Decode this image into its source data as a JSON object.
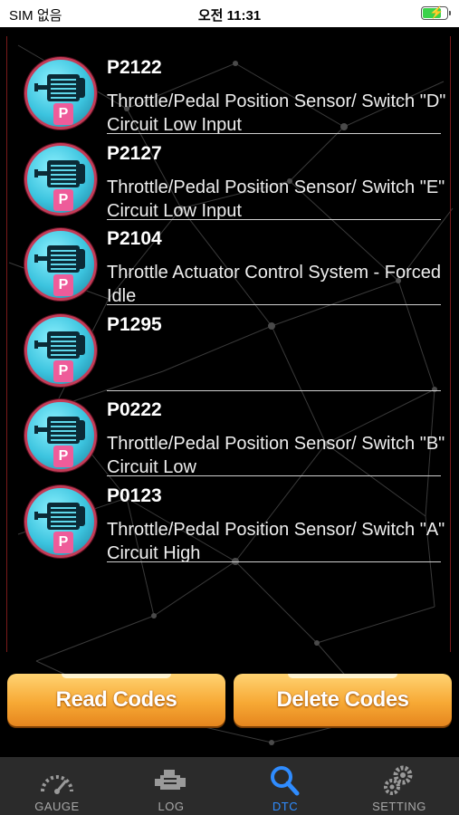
{
  "status_bar": {
    "carrier": "SIM 없음",
    "time": "오전 11:31"
  },
  "dtc_list": [
    {
      "code": "P2122",
      "description": "Throttle/Pedal Position Sensor/ Switch \"D\" Circuit Low Input",
      "icon": "motor-icon",
      "badge": "P"
    },
    {
      "code": "P2127",
      "description": "Throttle/Pedal Position Sensor/ Switch \"E\" Circuit Low Input",
      "icon": "motor-icon",
      "badge": "P"
    },
    {
      "code": "P2104",
      "description": "Throttle Actuator Control System - Forced Idle",
      "icon": "motor-icon",
      "badge": "P"
    },
    {
      "code": "P1295",
      "description": "",
      "icon": "motor-icon",
      "badge": "P"
    },
    {
      "code": "P0222",
      "description": "Throttle/Pedal Position Sensor/ Switch \"B\" Circuit Low",
      "icon": "motor-icon",
      "badge": "P"
    },
    {
      "code": "P0123",
      "description": "Throttle/Pedal Position Sensor/ Switch \"A\" Circuit High",
      "icon": "motor-icon",
      "badge": "P"
    }
  ],
  "buttons": {
    "read_codes": "Read Codes",
    "delete_codes": "Delete Codes"
  },
  "tab_bar": {
    "tabs": [
      {
        "label": "GAUGE",
        "icon": "gauge-icon",
        "active": false
      },
      {
        "label": "LOG",
        "icon": "engine-icon",
        "active": false
      },
      {
        "label": "DTC",
        "icon": "search-icon",
        "active": true
      },
      {
        "label": "SETTING",
        "icon": "gears-icon",
        "active": false
      }
    ]
  },
  "colors": {
    "accent": "#2f8cff",
    "button": "#f7a935",
    "icon_ring": "#c43b57",
    "background": "#000000"
  }
}
